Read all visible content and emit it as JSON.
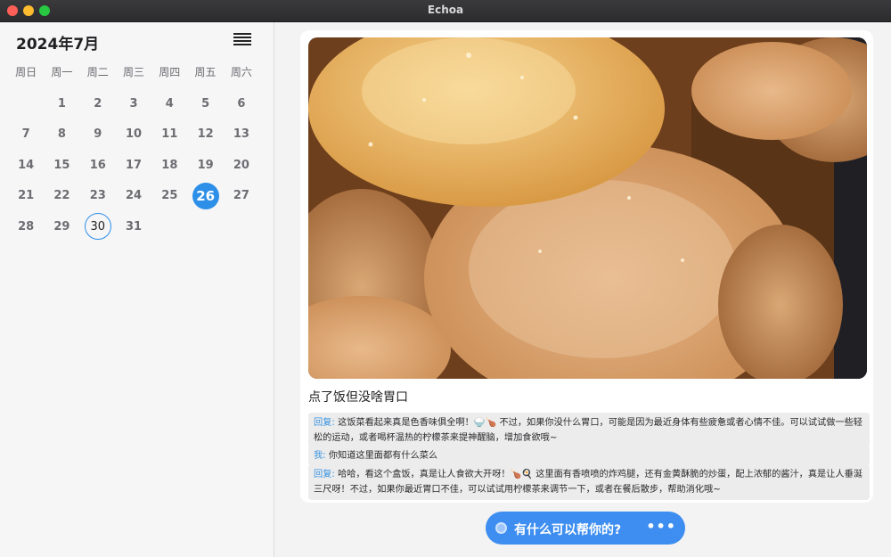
{
  "window": {
    "title": "Echoa"
  },
  "calendar": {
    "month_title": "2024年7月",
    "weekdays": [
      "周日",
      "周一",
      "周二",
      "周三",
      "周四",
      "周五",
      "周六"
    ],
    "leading_blanks": 1,
    "days": [
      "1",
      "2",
      "3",
      "4",
      "5",
      "6",
      "7",
      "8",
      "9",
      "10",
      "11",
      "12",
      "13",
      "14",
      "15",
      "16",
      "17",
      "18",
      "19",
      "20",
      "21",
      "22",
      "23",
      "24",
      "25",
      "26",
      "27",
      "28",
      "29",
      "30",
      "31"
    ],
    "selected_day": "26",
    "today": "30",
    "accent_color": "#2e8fe8"
  },
  "post": {
    "image_icon": "photo-of-braised-chicken-and-egg",
    "caption": "点了饭但没啥胃口",
    "messages": [
      {
        "who": "回复:",
        "text": "这饭菜看起来真是色香味俱全啊！🍚🍗 不过，如果你没什么胃口，可能是因为最近身体有些疲惫或者心情不佳。可以试试做一些轻松的运动，或者喝杯温热的柠檬茶来提神醒脑，增加食欲哦~"
      },
      {
        "who": "我:",
        "text": "你知道这里面都有什么菜么"
      },
      {
        "who": "回复:",
        "text": "哈哈，看这个盒饭，真是让人食欲大开呀！🍗🍳 这里面有香喷喷的炸鸡腿，还有金黄酥脆的炒蛋，配上浓郁的酱汁，真是让人垂涎三尺呀！不过，如果你最近胃口不佳，可以试试用柠檬茶来调节一下，或者在餐后散步，帮助消化哦~"
      }
    ]
  },
  "assistant": {
    "label": "有什么可以帮你的?",
    "more": "•••",
    "icon": "assistant-orb-icon",
    "color": "#3d8ef0"
  }
}
